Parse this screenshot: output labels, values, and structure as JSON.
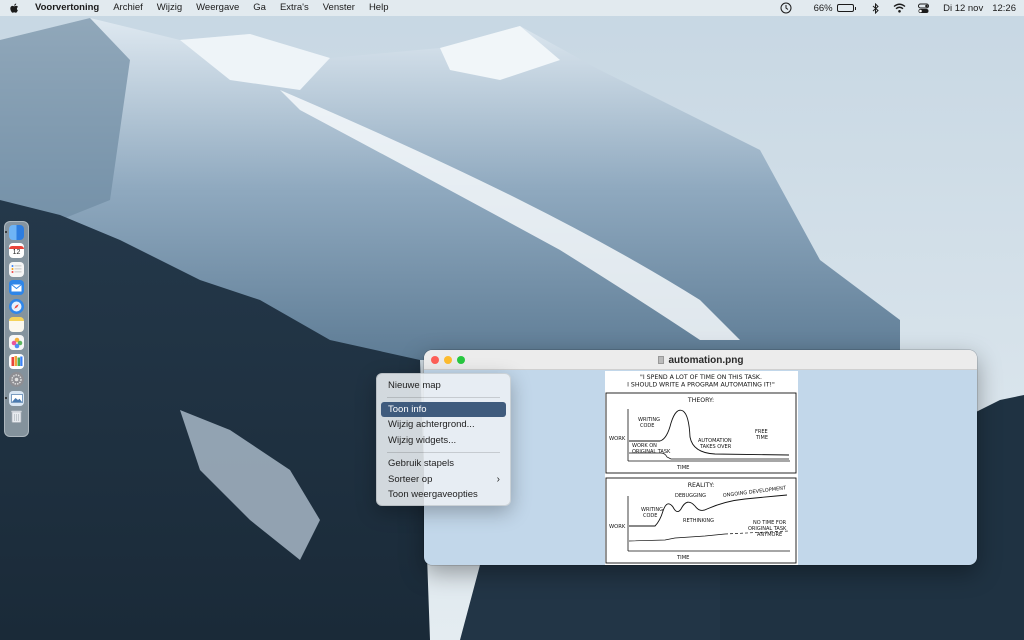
{
  "menubar": {
    "apple_icon": "apple-logo-icon",
    "app_name": "Voorvertoning",
    "menus": [
      "Archief",
      "Wijzig",
      "Weergave",
      "Ga",
      "Extra's",
      "Venster",
      "Help"
    ],
    "status": {
      "battery_percent": "66%",
      "battery_level": 0.66,
      "date": "Di 12 nov",
      "time": "12:26"
    }
  },
  "dock": {
    "apps": [
      {
        "name": "finder",
        "color": "#3d8fe6"
      },
      {
        "name": "calendar",
        "color": "#ffffff",
        "label": "12"
      },
      {
        "name": "reminders",
        "color": "#f4f4f4"
      },
      {
        "name": "mail",
        "color": "#2f86e8"
      },
      {
        "name": "safari",
        "color": "#2f86e8"
      },
      {
        "name": "notes",
        "color": "#f6e9a8"
      },
      {
        "name": "photos",
        "color": "#f7f7f7"
      },
      {
        "name": "books",
        "color": "#f0a23a"
      },
      {
        "name": "system-settings",
        "color": "#8e8e93"
      },
      {
        "name": "preview",
        "color": "#a9c4e0"
      },
      {
        "name": "trash",
        "color": "#d9dde2"
      }
    ]
  },
  "window": {
    "title": "automation.png",
    "comic": {
      "caption_line1": "\"I SPEND A LOT OF TIME ON THIS TASK.",
      "caption_line2": "I SHOULD WRITE A PROGRAM AUTOMATING IT!\"",
      "theory": {
        "title": "THEORY:",
        "y_label": "WORK",
        "x_label": "TIME",
        "writing_code": [
          "WRITING",
          "CODE"
        ],
        "work_on_task": [
          "WORK ON",
          "ORIGINAL TASK"
        ],
        "automation": [
          "AUTOMATION",
          "TAKES OVER"
        ],
        "free_time": [
          "FREE",
          "TIME"
        ]
      },
      "reality": {
        "title": "REALITY:",
        "y_label": "WORK",
        "x_label": "TIME",
        "writing_code": [
          "WRITING",
          "CODE"
        ],
        "debugging": "DEBUGGING",
        "rethinking": "RETHINKING",
        "ongoing": "ONGOING DEVELOPMENT",
        "no_time": [
          "NO TIME FOR",
          "ORIGINAL TASK",
          "ANYMORE"
        ]
      }
    }
  },
  "context_menu": {
    "group1": [
      "Nieuwe map"
    ],
    "group2": [
      "Toon info",
      "Wijzig achtergrond...",
      "Wijzig widgets..."
    ],
    "group3": [
      "Gebruik stapels",
      "Sorteer op",
      "Toon weergaveopties"
    ],
    "highlighted": "Toon info"
  }
}
